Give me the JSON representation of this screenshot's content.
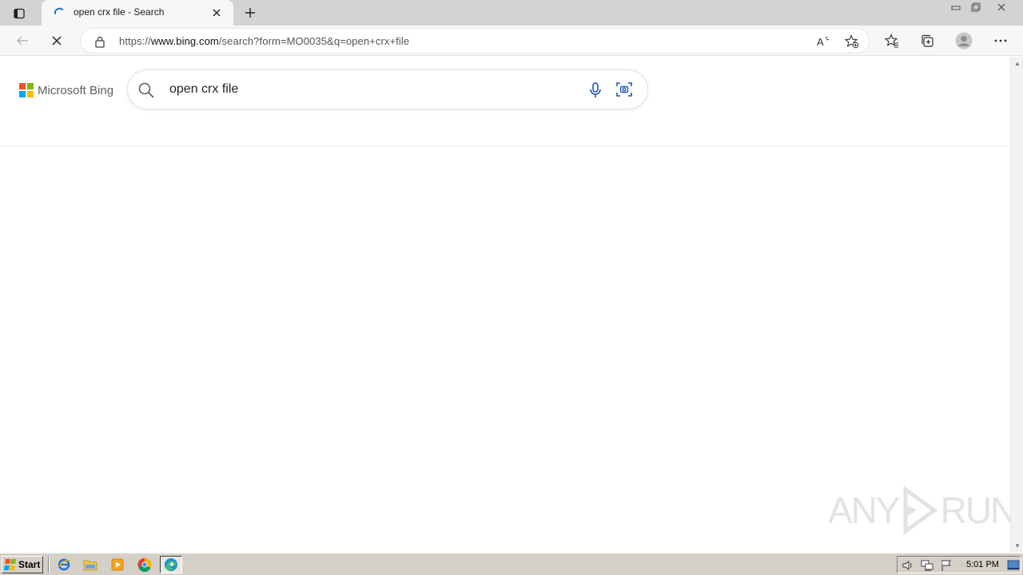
{
  "browser": {
    "tab": {
      "title": "open crx file - Search"
    },
    "address": {
      "url_prefix": "https://",
      "url_host": "www.bing.com",
      "url_path": "/search?form=MO0035&q=open+crx+file"
    }
  },
  "bing": {
    "logo_text": "Microsoft Bing",
    "search": {
      "query": "open crx file"
    },
    "logo_colors": [
      "#f25022",
      "#7fba00",
      "#00a4ef",
      "#ffb900"
    ]
  },
  "watermark": {
    "left": "ANY",
    "right": "RUN"
  },
  "taskbar": {
    "start_label": "Start",
    "clock": "5:01 PM"
  },
  "icons": {
    "tab_actions": "tab-actions-icon",
    "loading": "loading-spinner-icon",
    "close": "close-icon",
    "new_tab": "plus-icon",
    "back": "back-arrow-icon",
    "stop": "stop-x-icon",
    "lock": "lock-icon",
    "read_aloud": "read-aloud-icon",
    "add_favorite": "add-favorite-icon",
    "favorites": "favorites-icon",
    "collections": "collections-icon",
    "profile": "profile-icon",
    "more": "more-icon"
  }
}
